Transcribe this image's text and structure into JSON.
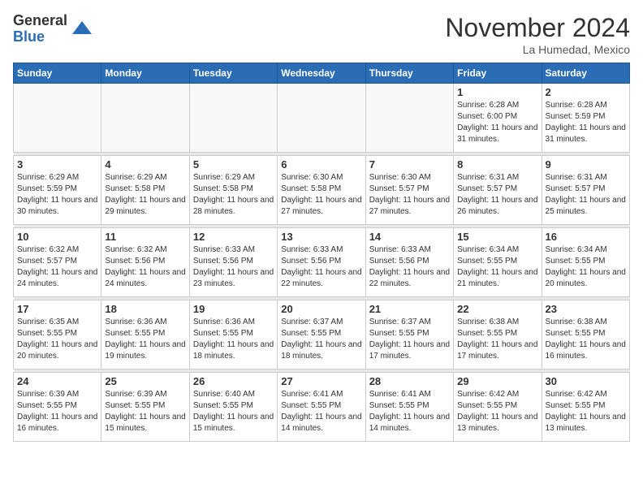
{
  "header": {
    "logo_line1": "General",
    "logo_line2": "Blue",
    "month": "November 2024",
    "location": "La Humedad, Mexico"
  },
  "days_of_week": [
    "Sunday",
    "Monday",
    "Tuesday",
    "Wednesday",
    "Thursday",
    "Friday",
    "Saturday"
  ],
  "weeks": [
    [
      {
        "day": "",
        "empty": true
      },
      {
        "day": "",
        "empty": true
      },
      {
        "day": "",
        "empty": true
      },
      {
        "day": "",
        "empty": true
      },
      {
        "day": "",
        "empty": true
      },
      {
        "day": "1",
        "sunrise": "Sunrise: 6:28 AM",
        "sunset": "Sunset: 6:00 PM",
        "daylight": "Daylight: 11 hours and 31 minutes."
      },
      {
        "day": "2",
        "sunrise": "Sunrise: 6:28 AM",
        "sunset": "Sunset: 5:59 PM",
        "daylight": "Daylight: 11 hours and 31 minutes."
      }
    ],
    [
      {
        "day": "3",
        "sunrise": "Sunrise: 6:29 AM",
        "sunset": "Sunset: 5:59 PM",
        "daylight": "Daylight: 11 hours and 30 minutes."
      },
      {
        "day": "4",
        "sunrise": "Sunrise: 6:29 AM",
        "sunset": "Sunset: 5:58 PM",
        "daylight": "Daylight: 11 hours and 29 minutes."
      },
      {
        "day": "5",
        "sunrise": "Sunrise: 6:29 AM",
        "sunset": "Sunset: 5:58 PM",
        "daylight": "Daylight: 11 hours and 28 minutes."
      },
      {
        "day": "6",
        "sunrise": "Sunrise: 6:30 AM",
        "sunset": "Sunset: 5:58 PM",
        "daylight": "Daylight: 11 hours and 27 minutes."
      },
      {
        "day": "7",
        "sunrise": "Sunrise: 6:30 AM",
        "sunset": "Sunset: 5:57 PM",
        "daylight": "Daylight: 11 hours and 27 minutes."
      },
      {
        "day": "8",
        "sunrise": "Sunrise: 6:31 AM",
        "sunset": "Sunset: 5:57 PM",
        "daylight": "Daylight: 11 hours and 26 minutes."
      },
      {
        "day": "9",
        "sunrise": "Sunrise: 6:31 AM",
        "sunset": "Sunset: 5:57 PM",
        "daylight": "Daylight: 11 hours and 25 minutes."
      }
    ],
    [
      {
        "day": "10",
        "sunrise": "Sunrise: 6:32 AM",
        "sunset": "Sunset: 5:57 PM",
        "daylight": "Daylight: 11 hours and 24 minutes."
      },
      {
        "day": "11",
        "sunrise": "Sunrise: 6:32 AM",
        "sunset": "Sunset: 5:56 PM",
        "daylight": "Daylight: 11 hours and 24 minutes."
      },
      {
        "day": "12",
        "sunrise": "Sunrise: 6:33 AM",
        "sunset": "Sunset: 5:56 PM",
        "daylight": "Daylight: 11 hours and 23 minutes."
      },
      {
        "day": "13",
        "sunrise": "Sunrise: 6:33 AM",
        "sunset": "Sunset: 5:56 PM",
        "daylight": "Daylight: 11 hours and 22 minutes."
      },
      {
        "day": "14",
        "sunrise": "Sunrise: 6:33 AM",
        "sunset": "Sunset: 5:56 PM",
        "daylight": "Daylight: 11 hours and 22 minutes."
      },
      {
        "day": "15",
        "sunrise": "Sunrise: 6:34 AM",
        "sunset": "Sunset: 5:55 PM",
        "daylight": "Daylight: 11 hours and 21 minutes."
      },
      {
        "day": "16",
        "sunrise": "Sunrise: 6:34 AM",
        "sunset": "Sunset: 5:55 PM",
        "daylight": "Daylight: 11 hours and 20 minutes."
      }
    ],
    [
      {
        "day": "17",
        "sunrise": "Sunrise: 6:35 AM",
        "sunset": "Sunset: 5:55 PM",
        "daylight": "Daylight: 11 hours and 20 minutes."
      },
      {
        "day": "18",
        "sunrise": "Sunrise: 6:36 AM",
        "sunset": "Sunset: 5:55 PM",
        "daylight": "Daylight: 11 hours and 19 minutes."
      },
      {
        "day": "19",
        "sunrise": "Sunrise: 6:36 AM",
        "sunset": "Sunset: 5:55 PM",
        "daylight": "Daylight: 11 hours and 18 minutes."
      },
      {
        "day": "20",
        "sunrise": "Sunrise: 6:37 AM",
        "sunset": "Sunset: 5:55 PM",
        "daylight": "Daylight: 11 hours and 18 minutes."
      },
      {
        "day": "21",
        "sunrise": "Sunrise: 6:37 AM",
        "sunset": "Sunset: 5:55 PM",
        "daylight": "Daylight: 11 hours and 17 minutes."
      },
      {
        "day": "22",
        "sunrise": "Sunrise: 6:38 AM",
        "sunset": "Sunset: 5:55 PM",
        "daylight": "Daylight: 11 hours and 17 minutes."
      },
      {
        "day": "23",
        "sunrise": "Sunrise: 6:38 AM",
        "sunset": "Sunset: 5:55 PM",
        "daylight": "Daylight: 11 hours and 16 minutes."
      }
    ],
    [
      {
        "day": "24",
        "sunrise": "Sunrise: 6:39 AM",
        "sunset": "Sunset: 5:55 PM",
        "daylight": "Daylight: 11 hours and 16 minutes."
      },
      {
        "day": "25",
        "sunrise": "Sunrise: 6:39 AM",
        "sunset": "Sunset: 5:55 PM",
        "daylight": "Daylight: 11 hours and 15 minutes."
      },
      {
        "day": "26",
        "sunrise": "Sunrise: 6:40 AM",
        "sunset": "Sunset: 5:55 PM",
        "daylight": "Daylight: 11 hours and 15 minutes."
      },
      {
        "day": "27",
        "sunrise": "Sunrise: 6:41 AM",
        "sunset": "Sunset: 5:55 PM",
        "daylight": "Daylight: 11 hours and 14 minutes."
      },
      {
        "day": "28",
        "sunrise": "Sunrise: 6:41 AM",
        "sunset": "Sunset: 5:55 PM",
        "daylight": "Daylight: 11 hours and 14 minutes."
      },
      {
        "day": "29",
        "sunrise": "Sunrise: 6:42 AM",
        "sunset": "Sunset: 5:55 PM",
        "daylight": "Daylight: 11 hours and 13 minutes."
      },
      {
        "day": "30",
        "sunrise": "Sunrise: 6:42 AM",
        "sunset": "Sunset: 5:55 PM",
        "daylight": "Daylight: 11 hours and 13 minutes."
      }
    ]
  ]
}
